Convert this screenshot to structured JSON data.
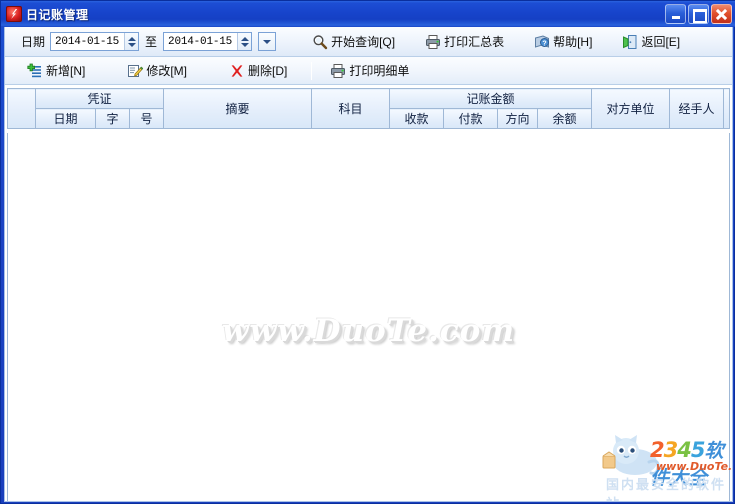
{
  "window": {
    "title": "日记账管理",
    "icon": "app-icon",
    "controls": {
      "minimize": "最小化",
      "maximize": "最大化",
      "close": "关闭"
    }
  },
  "toolbar_query": {
    "date_label": "日期",
    "date_from": "2014-01-15",
    "date_to": "2014-01-15",
    "between_label": "至",
    "dropdown_icon": "chevron-down-icon",
    "buttons": [
      {
        "label": "开始查询[Q]",
        "key": "Q",
        "text": "开始查询[",
        "tail": "]",
        "icon": "search-icon"
      },
      {
        "label": "打印汇总表",
        "text": "打印汇总表",
        "icon": "printer-icon"
      },
      {
        "label": "帮助[H]",
        "key": "H",
        "text": "帮助[",
        "tail": "]",
        "icon": "help-icon"
      },
      {
        "label": "返回[E]",
        "key": "E",
        "text": "返回[",
        "tail": "]",
        "icon": "exit-icon"
      }
    ]
  },
  "toolbar_edit": {
    "buttons": [
      {
        "label": "新增[N]",
        "key": "N",
        "text": "新增[",
        "tail": "]",
        "icon": "add-icon"
      },
      {
        "label": "修改[M]",
        "key": "M",
        "text": "修改[",
        "tail": "]",
        "icon": "edit-icon"
      },
      {
        "label": "删除[D]",
        "key": "D",
        "text": "删除[",
        "tail": "]",
        "icon": "delete-icon"
      },
      {
        "label": "打印明细单",
        "text": "打印明细单",
        "icon": "printer-icon"
      }
    ]
  },
  "grid": {
    "groups": {
      "voucher": "凭证",
      "summary": "摘要",
      "subject": "科目",
      "amount": "记账金额",
      "counterparty": "对方单位",
      "handler": "经手人"
    },
    "subheaders": {
      "voucher_date": "日期",
      "voucher_word": "字",
      "voucher_no": "号",
      "receipt": "收款",
      "payment": "付款",
      "direction": "方向",
      "balance": "余额"
    },
    "rows": []
  },
  "watermark": {
    "text": "www.DuoTe.com"
  },
  "brand": {
    "digits": [
      "2",
      "3",
      "4",
      "5"
    ],
    "suffix": "软件大全",
    "site": "www.DuoTe.com",
    "slogan": "国内最安全的软件站"
  },
  "colors": {
    "title_blue": "#1744cb",
    "frame_blue": "#1a3fbd",
    "header_blue": "#e4eefb",
    "header_border": "#9fb8d6",
    "accent_red": "#c2301a"
  }
}
